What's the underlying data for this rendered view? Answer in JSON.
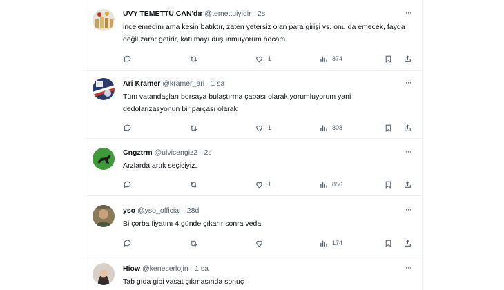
{
  "tweets": [
    {
      "name": "UVY TEMETTÜ CAN'dır",
      "handle": "@temettuiyidir",
      "time": "2s",
      "text": "incelemedim ama kesin batıktır, zaten yetersiz olan para girişi vs. onu da emecek, fayda değil zarar getirir, katılmayı düşünmüyorum hocam",
      "likes": "1",
      "views": "874"
    },
    {
      "name": "Ari Kramer",
      "handle": "@kramer_ari",
      "time": "1 sa",
      "text": "Tüm vatandaşları borsaya bulaştırma çabası olarak yorumluyorum yani dedolarizasyonun bir parçası olarak",
      "likes": "1",
      "views": "808"
    },
    {
      "name": "Cngztrm",
      "handle": "@ulvicengiz2",
      "time": "2s",
      "text": "Arzlarda artık seçiciyiz.",
      "likes": "1",
      "views": "856"
    },
    {
      "name": "yso",
      "handle": "@yso_official",
      "time": "28d",
      "text": "Bi çorba fiyatını 4 günde çıkarır sonra veda",
      "likes": "",
      "views": "174"
    },
    {
      "name": "Hiow",
      "handle": "@keneserlojin",
      "time": "1 sa",
      "text": "Tab gıda gibi vasat çıkmasında sonuç",
      "likes": "",
      "views": ""
    }
  ],
  "ui": {
    "separator": "·",
    "more": "···"
  }
}
